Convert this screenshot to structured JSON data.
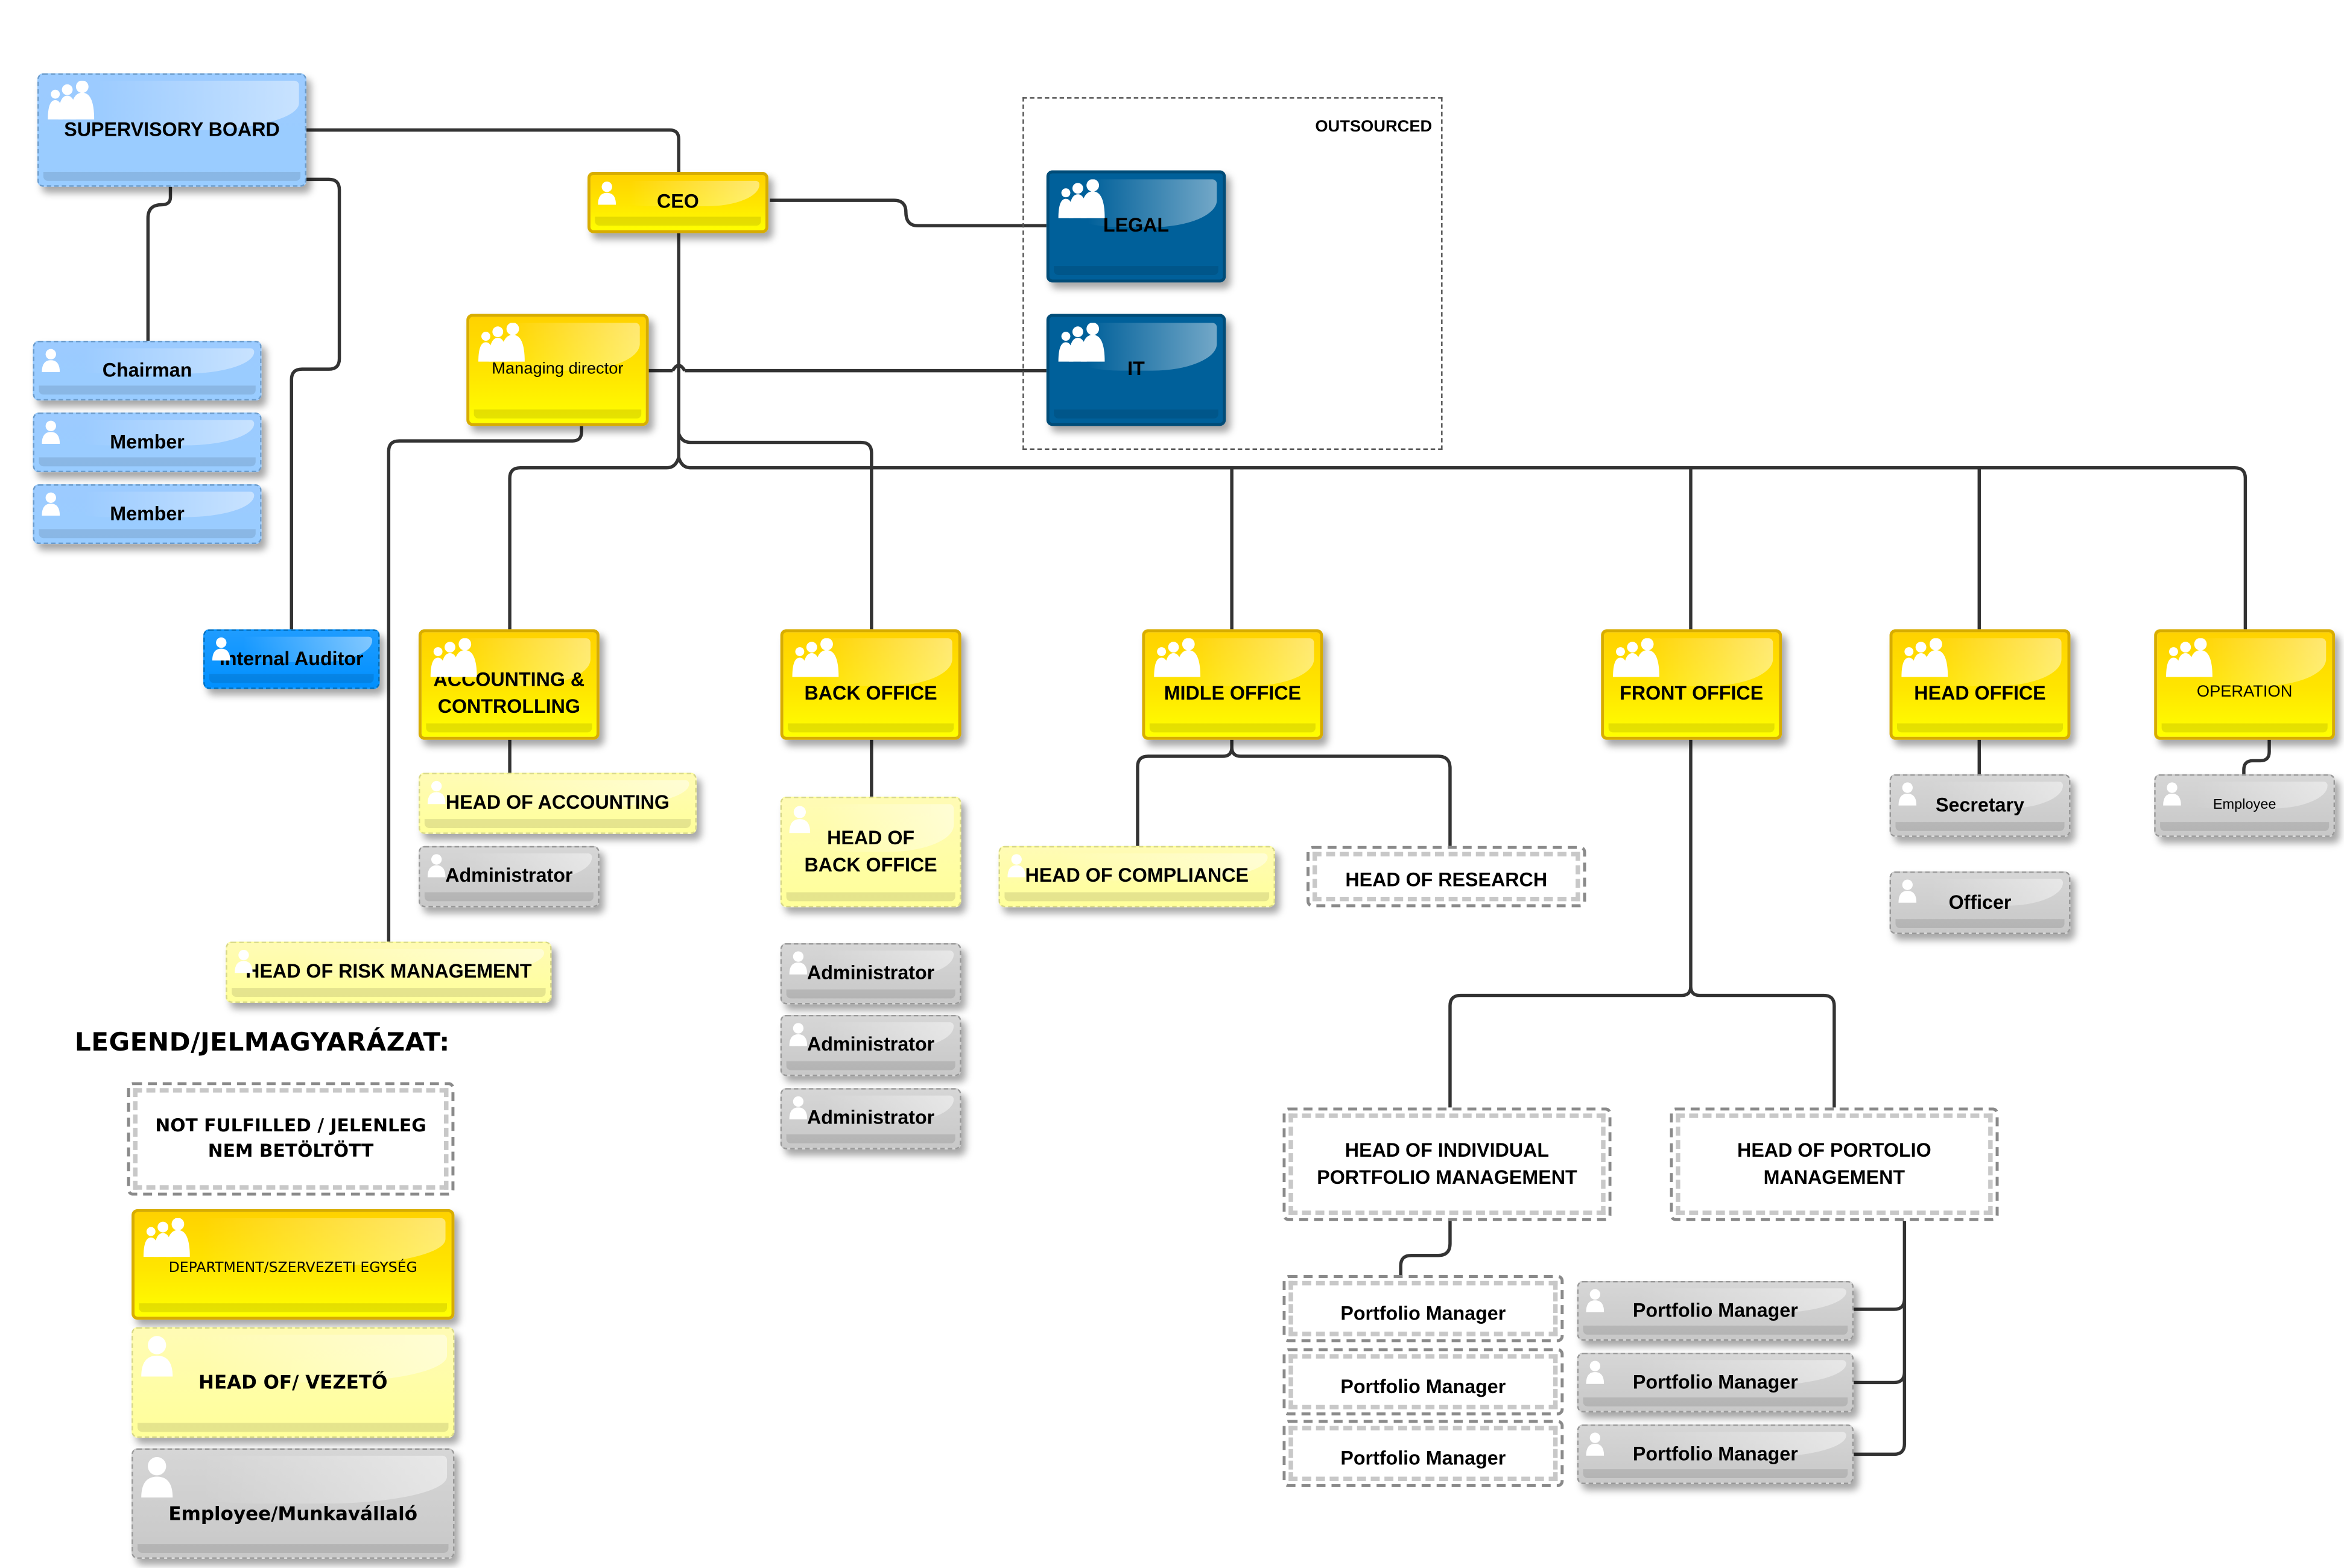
{
  "diagram": {
    "type": "organizational-chart",
    "outsourced_group": {
      "label": "OUTSOURCED"
    },
    "colors": {
      "department": "#FFE000",
      "head_of": "#FFFF99",
      "employee": "#CCCCCC",
      "board": "#99CCFF",
      "outsourced_unit": "#00609A",
      "internal_auditor": "#0090FF",
      "connector": "#333333"
    },
    "nodes": {
      "supervisory_board": {
        "label": "SUPERVISORY BOARD",
        "icon": "group-icon"
      },
      "chairman": {
        "label": "Chairman",
        "icon": "person-icon"
      },
      "member_1": {
        "label": "Member",
        "icon": "person-icon"
      },
      "member_2": {
        "label": "Member",
        "icon": "person-icon"
      },
      "internal_auditor": {
        "label": "Internal Auditor",
        "icon": "person-icon"
      },
      "ceo": {
        "label": "CEO",
        "icon": "person-icon"
      },
      "managing_director": {
        "label": "Managing director",
        "icon": "group-icon"
      },
      "legal": {
        "label": "LEGAL",
        "icon": "group-icon"
      },
      "it": {
        "label": "IT",
        "icon": "group-icon"
      },
      "accounting": {
        "label": "ACCOUNTING &\nCONTROLLING",
        "icon": "group-icon"
      },
      "head_of_accounting": {
        "label": "HEAD OF ACCOUNTING",
        "icon": "person-icon"
      },
      "accounting_admin": {
        "label": "Administrator",
        "icon": "person-icon"
      },
      "head_of_risk": {
        "label": "HEAD  OF RISK MANAGEMENT",
        "icon": "person-icon"
      },
      "back_office": {
        "label": "BACK OFFICE",
        "icon": "group-icon"
      },
      "head_of_back_office": {
        "label": "HEAD OF\nBACK  OFFICE",
        "icon": "person-icon"
      },
      "bo_admin_1": {
        "label": "Administrator",
        "icon": "person-icon"
      },
      "bo_admin_2": {
        "label": "Administrator",
        "icon": "person-icon"
      },
      "bo_admin_3": {
        "label": "Administrator",
        "icon": "person-icon"
      },
      "midle_office": {
        "label": "MIDLE OFFICE",
        "icon": "group-icon"
      },
      "head_of_compliance": {
        "label": "HEAD OF COMPLIANCE",
        "icon": "person-icon"
      },
      "head_of_research": {
        "label": "HEAD OF RESEARCH"
      },
      "front_office": {
        "label": "FRONT OFFICE",
        "icon": "group-icon"
      },
      "head_of_individual_pm": {
        "label": "HEAD OF INDIVIDUAL\nPORTFOLIO MANAGEMENT"
      },
      "head_of_pm": {
        "label": "HEAD  OF  PORTOLIO\nMANAGEMENT"
      },
      "ipm_1": {
        "label": "Portfolio Manager"
      },
      "ipm_2": {
        "label": "Portfolio Manager"
      },
      "ipm_3": {
        "label": "Portfolio Manager"
      },
      "pm_1": {
        "label": "Portfolio Manager",
        "icon": "person-icon"
      },
      "pm_2": {
        "label": "Portfolio Manager",
        "icon": "person-icon"
      },
      "pm_3": {
        "label": "Portfolio Manager",
        "icon": "person-icon"
      },
      "head_office": {
        "label": "HEAD OFFICE",
        "icon": "group-icon"
      },
      "secretary": {
        "label": "Secretary",
        "icon": "person-icon"
      },
      "officer": {
        "label": "Officer",
        "icon": "person-icon"
      },
      "operation": {
        "label": "OPERATION",
        "icon": "group-icon"
      },
      "employee": {
        "label": "Employee",
        "icon": "person-icon"
      }
    },
    "legend": {
      "title": "LEGEND/JELMAGYARÁZAT:",
      "items": [
        {
          "label": "NOT FULFILLED / JELENLEG\nNEM BETÖLTÖTT",
          "style": "not-fulfilled"
        },
        {
          "label": "DEPARTMENT/SZERVEZETI EGYSÉG",
          "style": "department",
          "icon": "group-icon"
        },
        {
          "label": "HEAD OF/ VEZETŐ",
          "style": "head-of",
          "icon": "person-icon"
        },
        {
          "label": "Employee/Munkavállaló",
          "style": "employee",
          "icon": "person-icon"
        }
      ]
    }
  }
}
